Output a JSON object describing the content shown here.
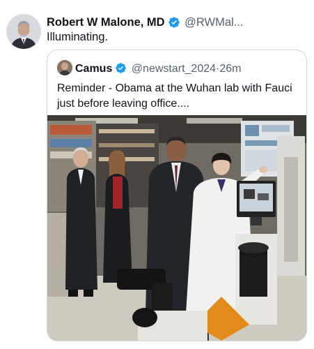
{
  "tweet": {
    "author_name": "Robert W Malone, MD",
    "handle": "@RWMal...",
    "text": "Illuminating.",
    "verified_icon": "verified-badge-icon"
  },
  "quoted_tweet": {
    "author_name": "Camus",
    "handle": "@newstart_2024",
    "separator": "·",
    "time": "26m",
    "text": "Reminder - Obama at the Wuhan lab with Fauci just before leaving office....",
    "verified_icon": "verified-badge-icon"
  },
  "colors": {
    "verified_blue": "#1d9bf0",
    "text_primary": "#0f1419",
    "text_secondary": "#536471",
    "border": "#cfd9de"
  }
}
